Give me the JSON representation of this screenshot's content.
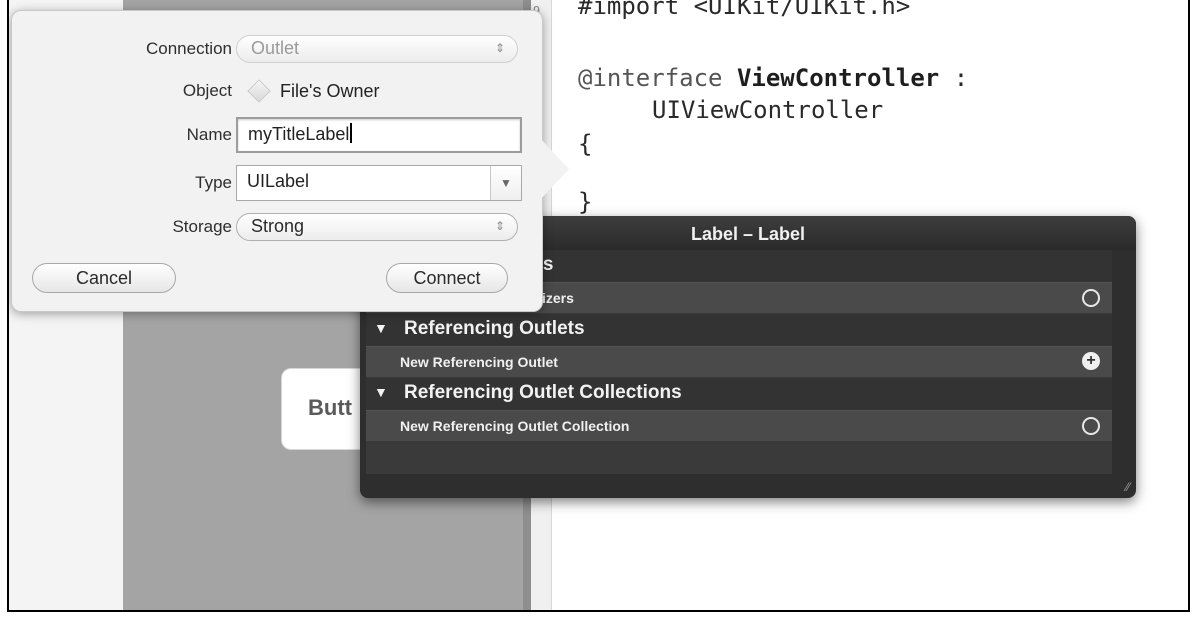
{
  "popover": {
    "connection_label": "Connection",
    "connection_value": "Outlet",
    "object_label": "Object",
    "object_value": "File's Owner",
    "name_label": "Name",
    "name_value": "myTitleLabel",
    "type_label": "Type",
    "type_value": "UILabel",
    "storage_label": "Storage",
    "storage_value": "Strong",
    "cancel_label": "Cancel",
    "connect_label": "Connect"
  },
  "canvas": {
    "button_label": "Butt"
  },
  "editor": {
    "gutter_numbers": [
      "9",
      "0",
      "1"
    ],
    "line1": "#import <UIKit/UIKit.h>",
    "line2_kw": "@interface ",
    "line2_name": "ViewController",
    "line2_tail": " :",
    "line3": "UIViewController",
    "line4": "{",
    "line5": "}"
  },
  "hud": {
    "title": "Label – Label",
    "section1_partial": "tions",
    "item1_partial": "izers",
    "section2": "Referencing Outlets",
    "item2": "New Referencing Outlet",
    "section3": "Referencing Outlet Collections",
    "item3": "New Referencing Outlet Collection",
    "triangle_glyph": "▼"
  },
  "icons": {
    "object_icon": "cube-icon",
    "stepper_icon": "updown-arrows-icon",
    "dropdown_icon": "chevron-down-icon",
    "outlet_empty_icon": "circle-icon",
    "outlet_add_icon": "plus-circle-icon",
    "resize_icon": "resize-grip-icon"
  },
  "colors": {
    "hud_bg": "#2e2e2e",
    "popover_bg": "#f2f2f2",
    "device_gray": "#a4a4a4"
  }
}
